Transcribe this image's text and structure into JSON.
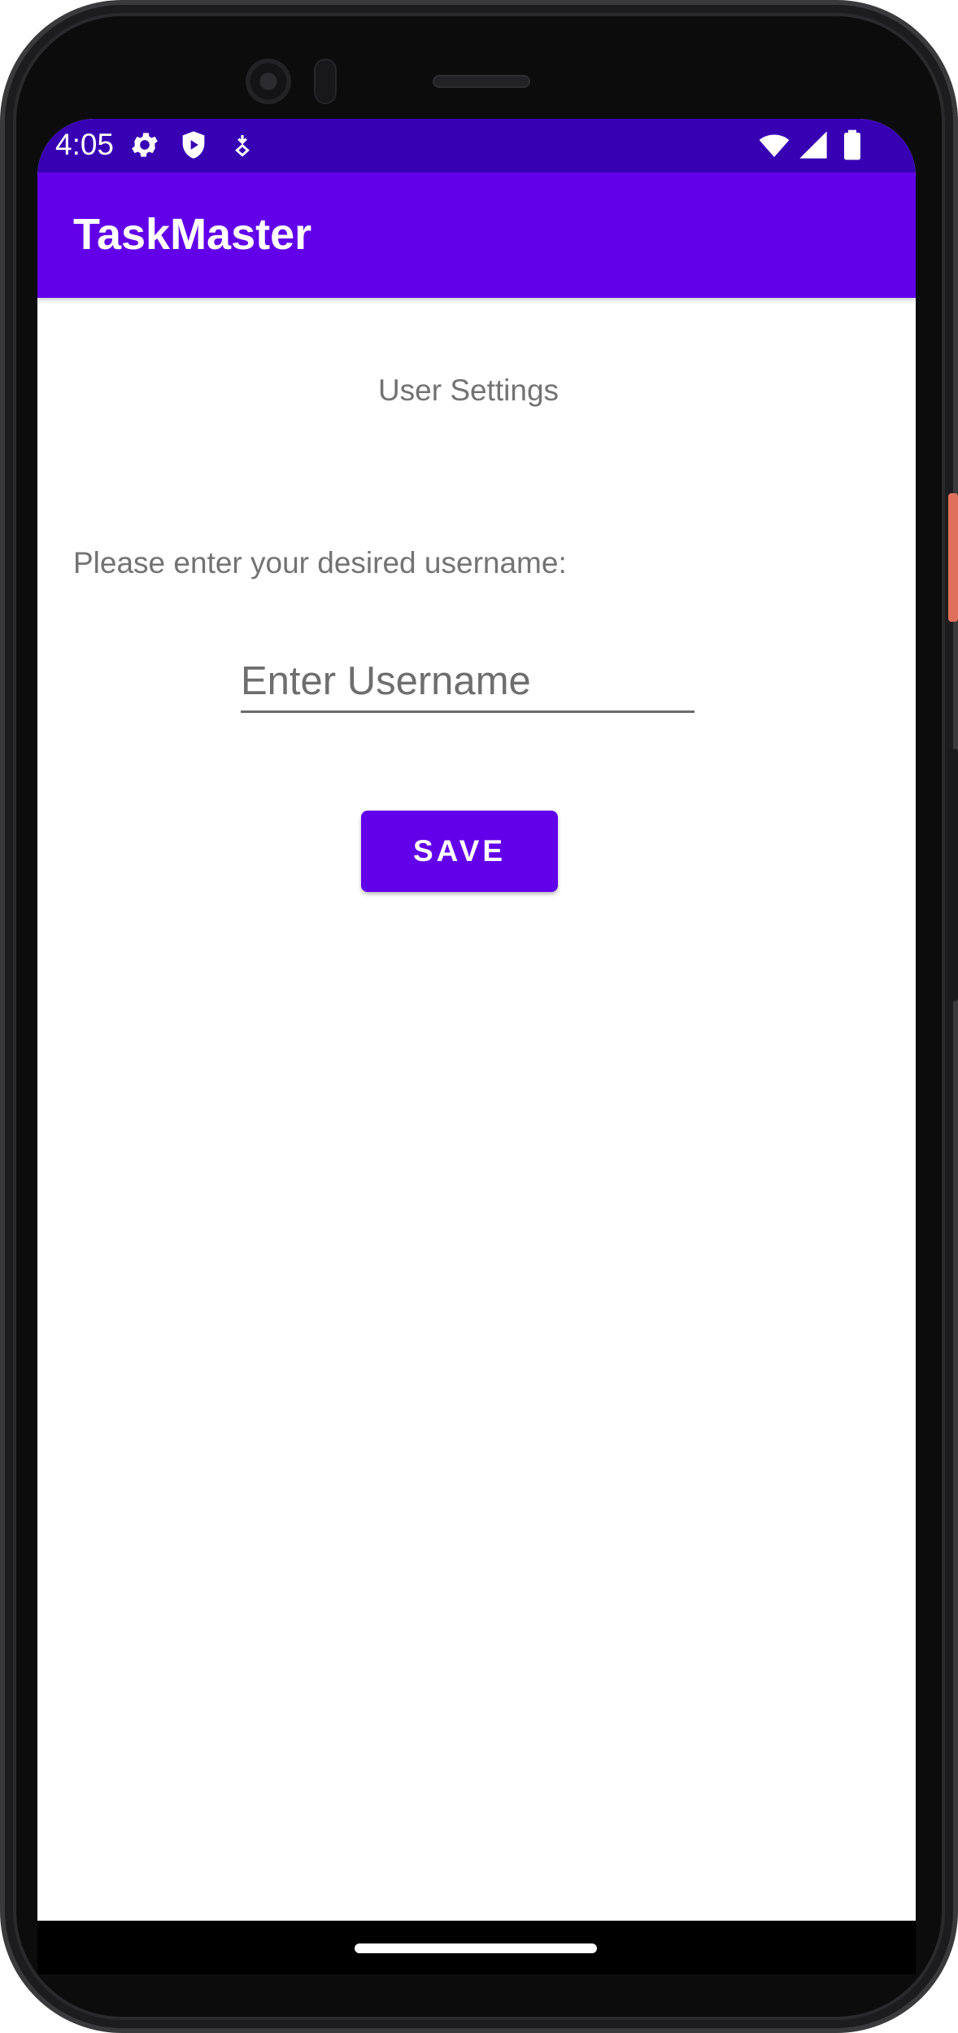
{
  "status_bar": {
    "time": "4:05",
    "icons_left": [
      "gear-icon",
      "shield-play-icon",
      "download-badge-icon"
    ],
    "icons_right": [
      "wifi-icon",
      "cell-signal-icon",
      "battery-icon"
    ],
    "color": "#3700b3"
  },
  "app_bar": {
    "title": "TaskMaster",
    "color": "#6200ea"
  },
  "settings": {
    "page_title": "User Settings",
    "prompt": "Please enter your desired username:",
    "username_value": "",
    "username_placeholder": "Enter Username",
    "save_label": "SAVE"
  },
  "colors": {
    "primary": "#6200ea",
    "primary_dark": "#3700b3",
    "secondary_text": "#737373"
  }
}
